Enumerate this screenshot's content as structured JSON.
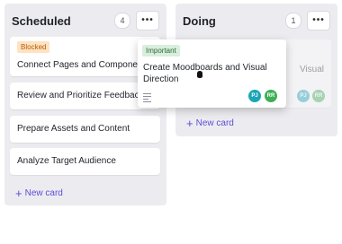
{
  "columns": [
    {
      "title": "Scheduled",
      "count": "4",
      "menu": "•••",
      "cards": [
        {
          "badge": "Blocked",
          "title": "Connect Pages and Components"
        },
        {
          "title": "Review and Prioritize Feedback"
        },
        {
          "title": "Prepare Assets and Content"
        },
        {
          "title": "Analyze Target Audience"
        }
      ],
      "new_card": "New card"
    },
    {
      "title": "Doing",
      "count": "1",
      "menu": "•••",
      "ghost_card": {
        "title_fragment": "Visual",
        "avatars": [
          "PJ",
          "RR"
        ]
      },
      "new_card": "New card"
    }
  ],
  "dragging_card": {
    "badge": "Important",
    "title": "Create Moodboards and Visual Direction",
    "avatars": [
      "PJ",
      "RR"
    ],
    "description_icon": "text-lines-icon"
  },
  "colors": {
    "accent": "#5a4ed8",
    "avatar_pj": "#1aa6b7",
    "avatar_rr": "#3fae55",
    "column_bg": "#ececf0"
  }
}
